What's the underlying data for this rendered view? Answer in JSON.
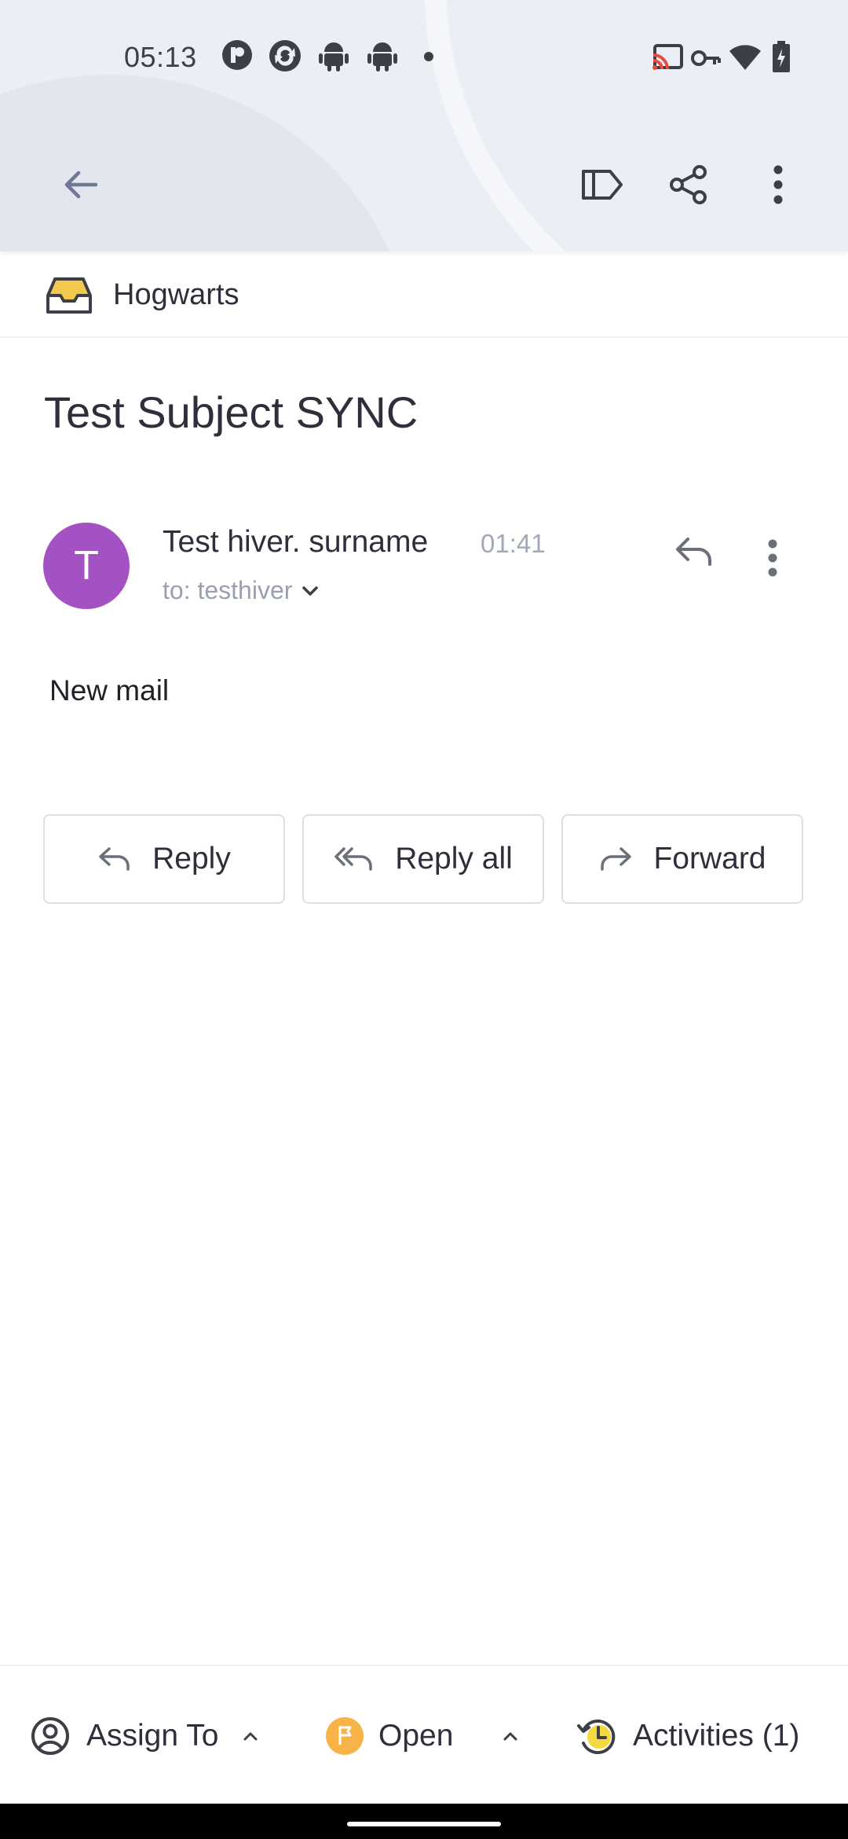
{
  "status_bar": {
    "time": "05:13"
  },
  "toolbar": {
    "back": "back-arrow-icon",
    "label": "label-icon",
    "share": "share-icon",
    "more": "more-vert-icon"
  },
  "inbox": {
    "name": "Hogwarts",
    "icon_color": "#f2c94c"
  },
  "email": {
    "subject": "Test Subject SYNC",
    "avatar_initial": "T",
    "avatar_color": "#a452c3",
    "sender": "Test hiver. surname",
    "time": "01:41",
    "to": "to: testhiver",
    "body": "New mail"
  },
  "actions": {
    "reply": "Reply",
    "reply_all": "Reply all",
    "forward": "Forward"
  },
  "bottom_bar": {
    "assign": "Assign To",
    "status": "Open",
    "status_color": "#f7b347",
    "activities": "Activities (1)"
  }
}
